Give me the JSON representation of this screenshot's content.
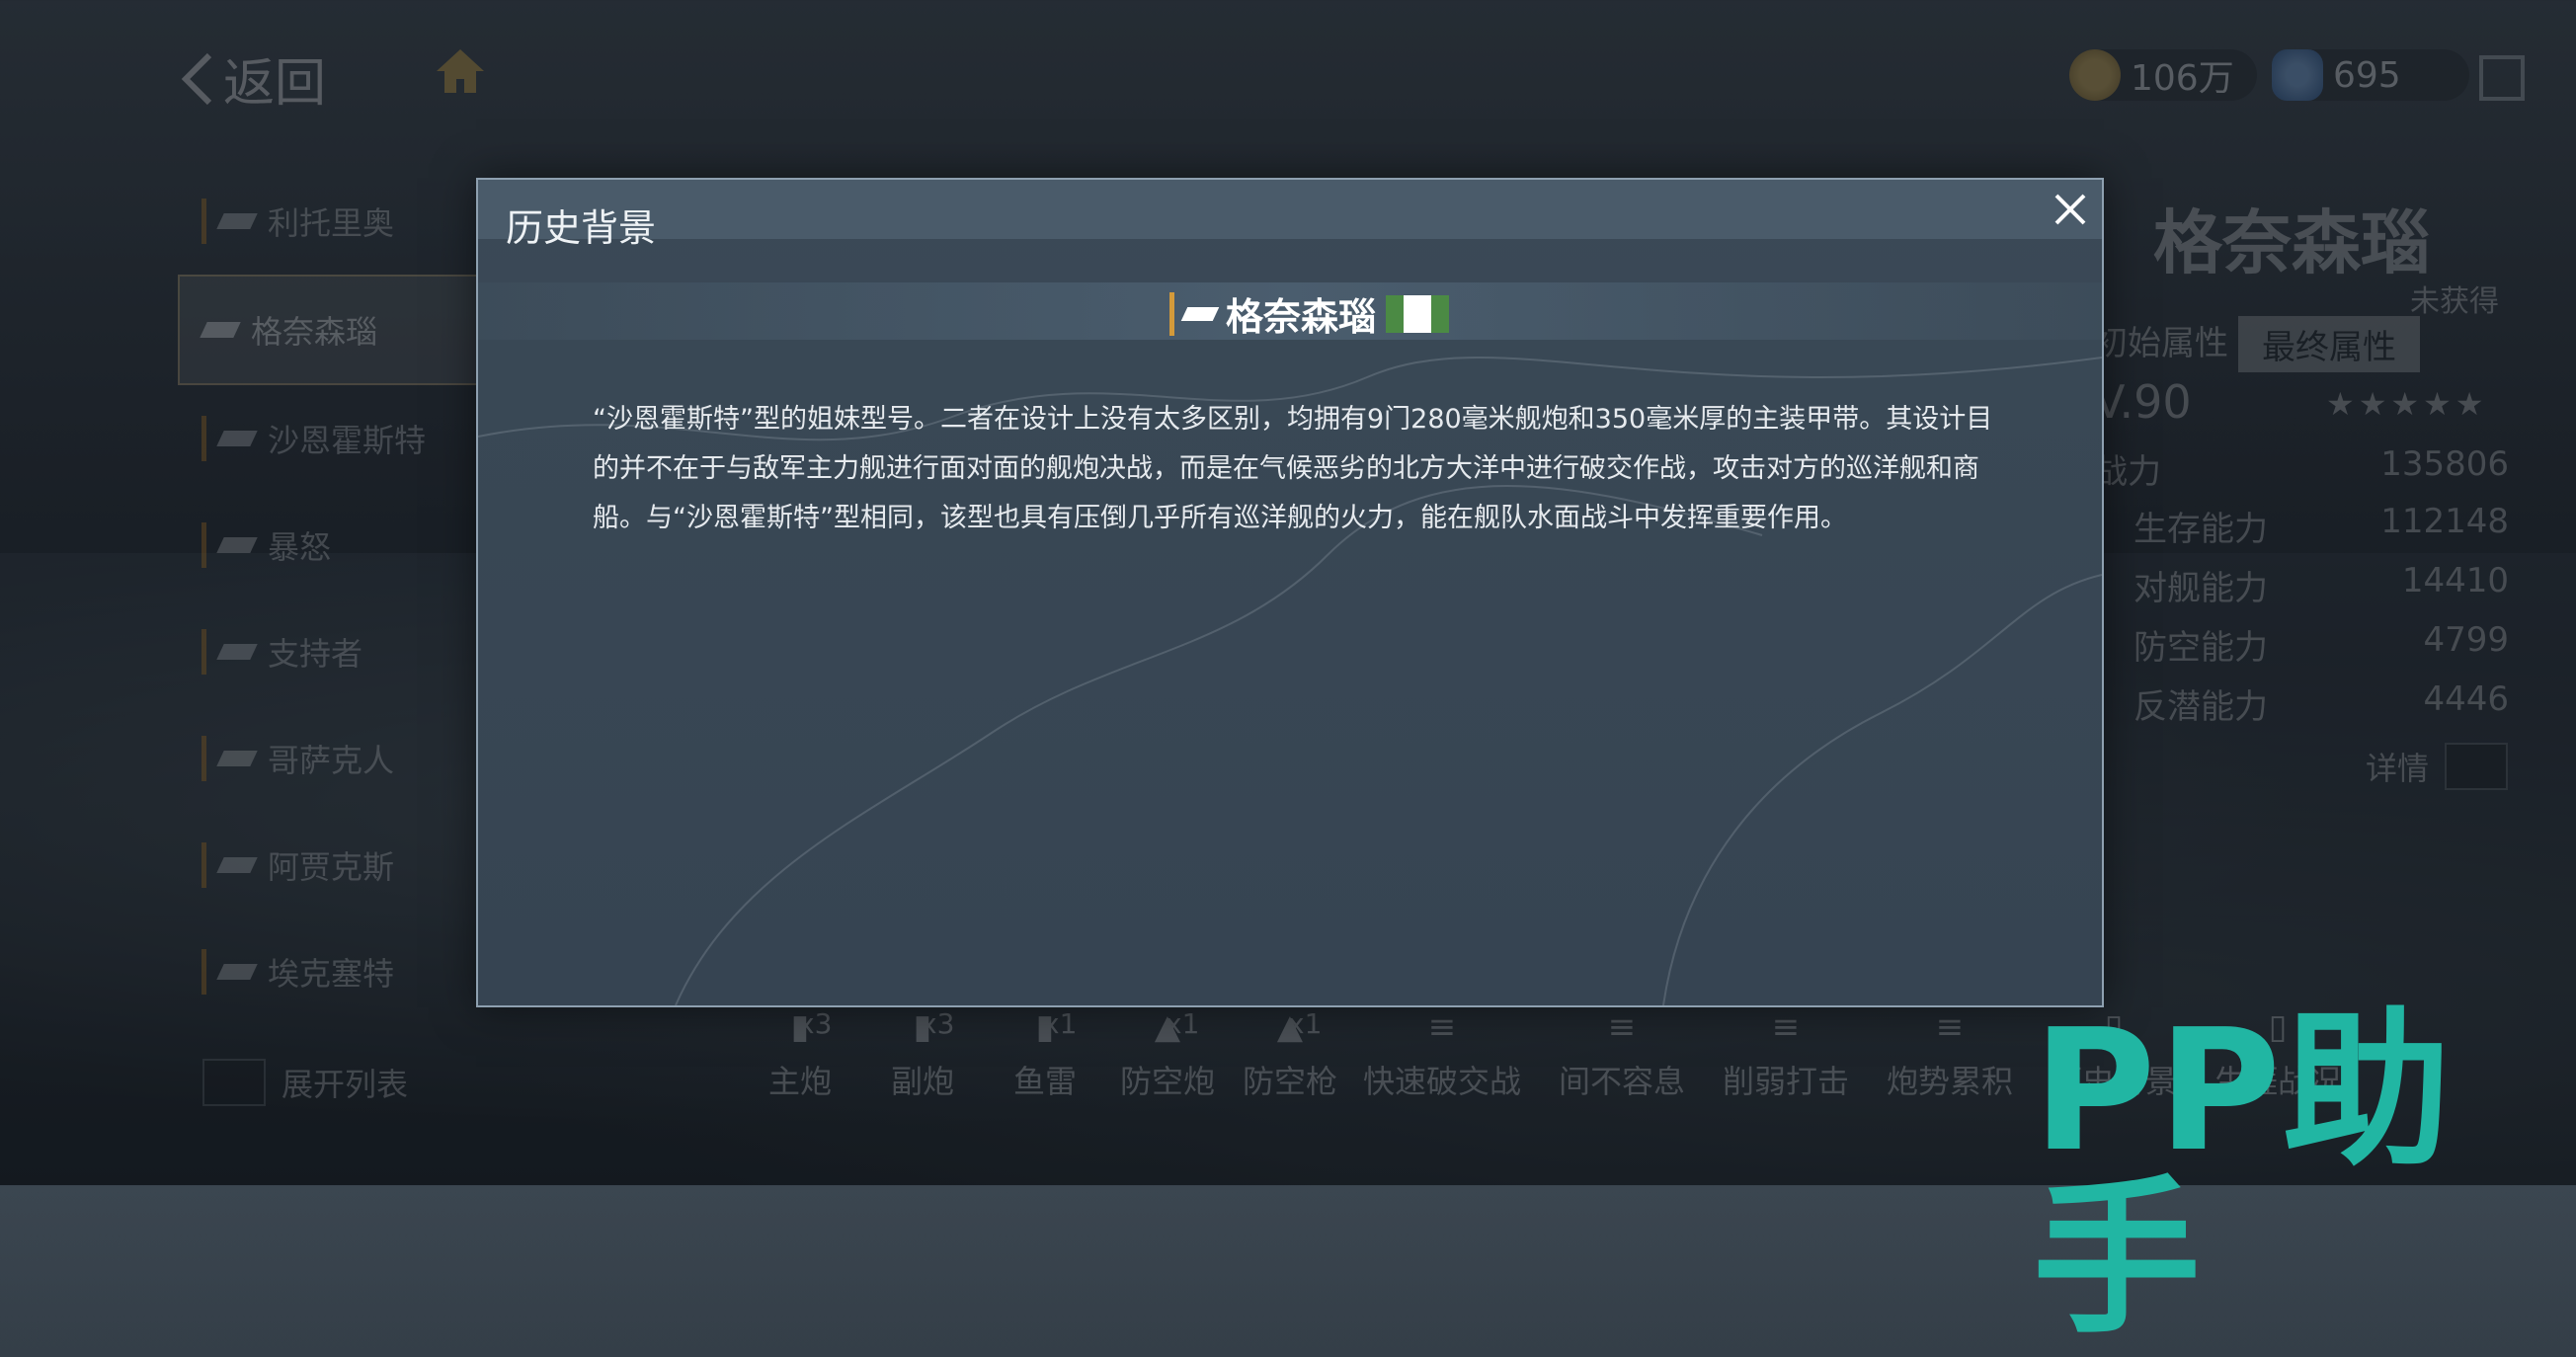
{
  "top_bar": {
    "back_label": "返回",
    "coins": "106万",
    "gems": "695"
  },
  "ship_list": {
    "items": [
      {
        "label": "利托里奥"
      },
      {
        "label": "格奈森瑙"
      },
      {
        "label": "沙恩霍斯特"
      },
      {
        "label": "暴怒"
      },
      {
        "label": "支持者"
      },
      {
        "label": "哥萨克人"
      },
      {
        "label": "阿贾克斯"
      },
      {
        "label": "埃克塞特"
      }
    ],
    "active_index": 1,
    "expand_label": "展开列表"
  },
  "right_panel": {
    "ship_name": "格奈森瑙",
    "status": "未获得",
    "tabs": [
      "初始属性",
      "最终属性"
    ],
    "level": "V.90",
    "stats": [
      {
        "label": "战力",
        "value": "135806"
      },
      {
        "label": "生存能力",
        "value": "112148"
      },
      {
        "label": "对舰能力",
        "value": "14410"
      },
      {
        "label": "防空能力",
        "value": "4799"
      },
      {
        "label": "反潜能力",
        "value": "4446"
      }
    ],
    "detail_label": "详情"
  },
  "bottom_bar": {
    "weapons": [
      {
        "label": "主炮",
        "count": "x3"
      },
      {
        "label": "副炮",
        "count": "x3"
      },
      {
        "label": "鱼雷",
        "count": "x1"
      },
      {
        "label": "防空炮",
        "count": "x1"
      },
      {
        "label": "防空枪",
        "count": "x1"
      }
    ],
    "skills": [
      {
        "label": "快速破交战"
      },
      {
        "label": "间不容息"
      },
      {
        "label": "削弱打击"
      },
      {
        "label": "炮势累积"
      },
      {
        "label": "历史背景"
      },
      {
        "label": "生涯战况"
      }
    ]
  },
  "modal": {
    "title": "历史背景",
    "ship_name": "格奈森瑙",
    "flag_colors": [
      "#4b8a44",
      "#ffffff",
      "#4b8a44"
    ],
    "history_text": "“沙恩霍斯特”型的姐妹型号。二者在设计上没有太多区别，均拥有9门280毫米舰炮和350毫米厚的主装甲带。其设计目的并不在于与敌军主力舰进行面对面的舰炮决战，而是在气候恶劣的北方大洋中进行破交作战，攻击对方的巡洋舰和商船。与“沙恩霍斯特”型相同，该型也具有压倒几乎所有巡洋舰的火力，能在舰队水面战斗中发挥重要作用。"
  },
  "watermark": "PP助手",
  "accent_color": "#21b6a3"
}
